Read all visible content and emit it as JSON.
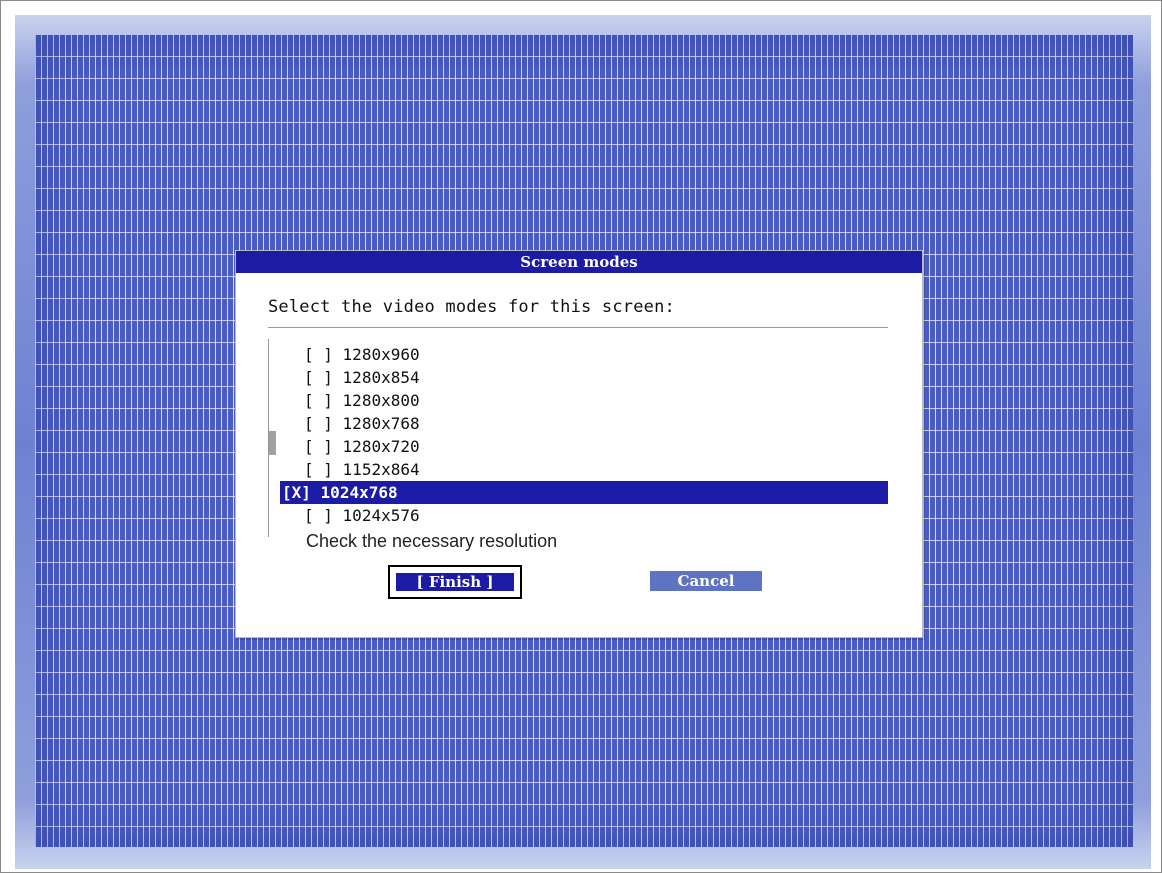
{
  "dialog": {
    "title": "Screen modes",
    "prompt": "Select the video modes for this screen:",
    "hint": "Check the necessary resolution"
  },
  "modes": [
    {
      "checkbox": "[ ]",
      "label": "1280x960",
      "checked": false
    },
    {
      "checkbox": "[ ]",
      "label": "1280x854",
      "checked": false
    },
    {
      "checkbox": "[ ]",
      "label": "1280x800",
      "checked": false
    },
    {
      "checkbox": "[ ]",
      "label": "1280x768",
      "checked": false
    },
    {
      "checkbox": "[ ]",
      "label": "1280x720",
      "checked": false
    },
    {
      "checkbox": "[ ]",
      "label": "1152x864",
      "checked": false
    },
    {
      "checkbox": "[X]",
      "label": "1024x768",
      "checked": true
    },
    {
      "checkbox": "[ ]",
      "label": "1024x576",
      "checked": false
    }
  ],
  "buttons": {
    "finish": "[ Finish ]",
    "cancel": "Cancel"
  },
  "colors": {
    "accent": "#1b1ba5",
    "cancel_bg": "#5e74c2",
    "screen_bg": "#4a5cc4"
  }
}
